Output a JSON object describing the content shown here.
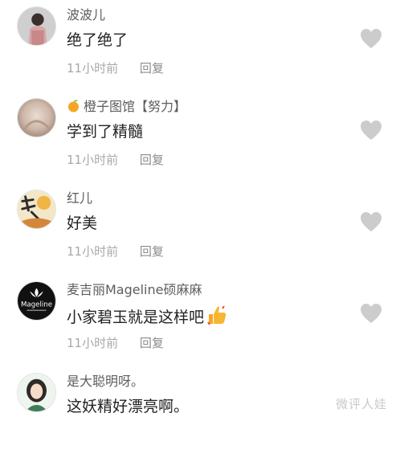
{
  "comments": [
    {
      "username": "波波儿",
      "text": "绝了绝了",
      "time": "11小时前",
      "reply_label": "回复",
      "avatar_icon": "person-photo-avatar"
    },
    {
      "username": "橙子图馆【努力】",
      "text": "学到了精髓",
      "time": "11小时前",
      "reply_label": "回复",
      "avatar_icon": "blurred-photo-avatar",
      "badge_icon": "orange-emoji-icon"
    },
    {
      "username": "红儿",
      "text": "好美",
      "time": "11小时前",
      "reply_label": "回复",
      "avatar_icon": "calligraphy-avatar"
    },
    {
      "username": "麦吉丽Mageline硕麻麻",
      "text": "小家碧玉就是这样吧",
      "time": "11小时前",
      "reply_label": "回复",
      "avatar_icon": "mageline-logo-avatar",
      "avatar_logo_text": "Mageline",
      "trailing_emoji": "thumbs-up-icon"
    },
    {
      "username": "是大聪明呀。",
      "text": "这妖精好漂亮啊。",
      "avatar_icon": "illustrated-woman-avatar"
    }
  ],
  "watermark": "微评人娃",
  "colors": {
    "username": "#5d5d5d",
    "text": "#222222",
    "meta": "#a8a8a8",
    "heart": "#cccccc"
  }
}
